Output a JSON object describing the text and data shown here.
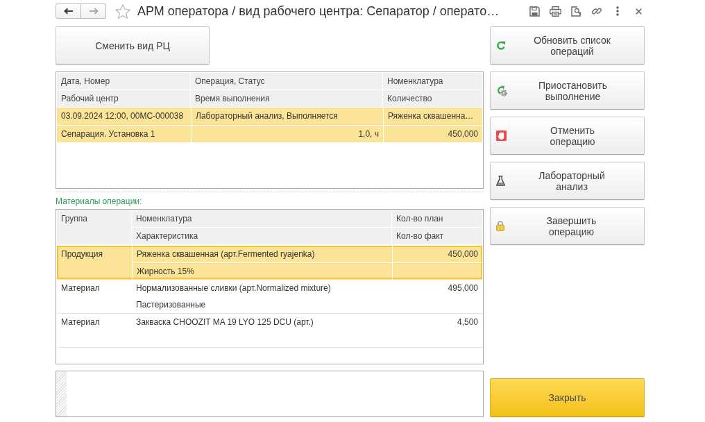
{
  "window": {
    "title": "АРМ оператора / вид рабочего центра: Сепаратор / операто…",
    "favorite": false,
    "navigation": {
      "back": {
        "disabled": false
      },
      "forward": {
        "disabled": true
      }
    }
  },
  "change_view_button": {
    "label": "Сменить вид РЦ"
  },
  "operations_table": {
    "header_rows": [
      [
        "Дата, Номер",
        "Операция, Статус",
        "Номенклатура"
      ],
      [
        "Рабочий центр",
        "Время выполнения",
        "Количество"
      ]
    ],
    "rows": [
      {
        "selected": true,
        "lines": [
          [
            "03.09.2024 12:00, 00МС-000038",
            "Лабораторный анализ, Выполняется",
            "Ряженка сквашенна…"
          ],
          [
            "Сепарация. Установка 1",
            "1,0, ч",
            "450,000"
          ]
        ]
      }
    ]
  },
  "materials": {
    "label": "Материалы операции:",
    "columns": {
      "group": "Группа",
      "item": "Номенклатура",
      "characteristic": "Характеристика",
      "planned": "Кол-во план",
      "actual": "Кол-во факт"
    },
    "rows": [
      {
        "group": "Продукция",
        "item": "Ряженка сквашенная (арт.Fermented ryajenka)",
        "characteristic": "Жирность 15%",
        "planned": "450,000",
        "selected": true
      },
      {
        "group": "Материал",
        "item": "Нормализованные сливки (арт.Normalized mixture)",
        "characteristic": "Пастеризованные",
        "planned": "495,000",
        "selected": false
      },
      {
        "group": "Материал",
        "item": "Закваска CHOOZIT MA 19 LYO 125 DCU (арт.)",
        "planned": "4,500",
        "selected": false
      }
    ]
  },
  "actions": [
    {
      "label": "Обновить список операций"
    },
    {
      "label": "Приостановить выполнение"
    },
    {
      "label": "Отменить операцию"
    },
    {
      "label": "Лабораторный анализ"
    },
    {
      "label": "Завершить операцию"
    }
  ],
  "close_button": {
    "label": "Закрыть"
  }
}
